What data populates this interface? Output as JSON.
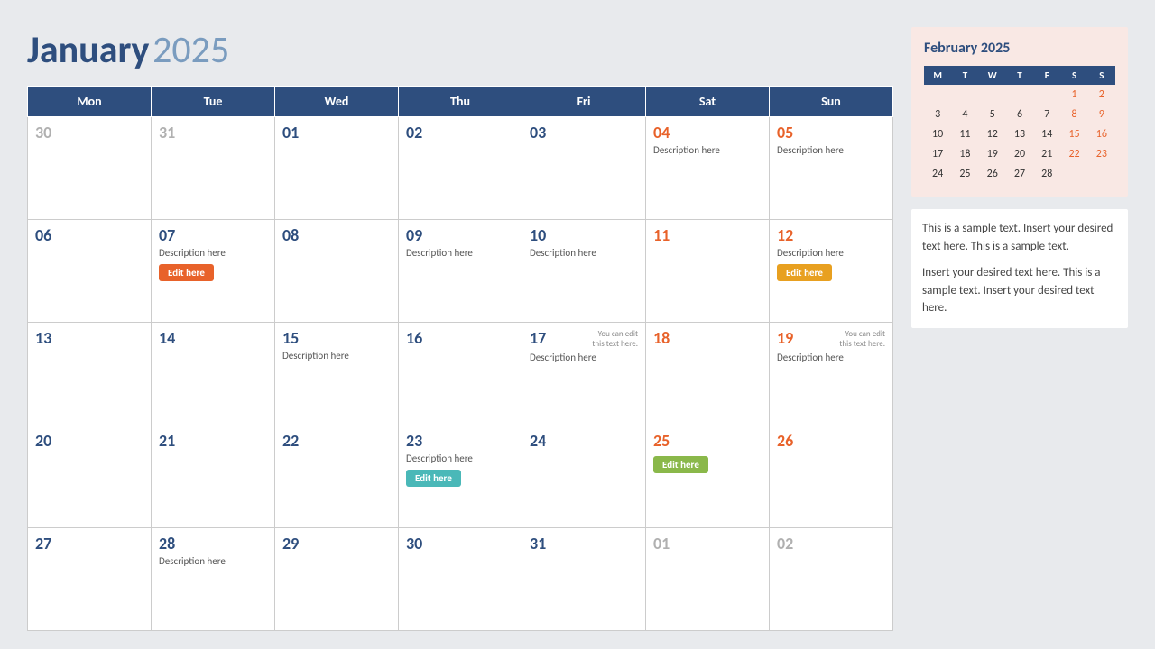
{
  "header": {
    "month": "January",
    "year": "2025"
  },
  "days_header": [
    "Mon",
    "Tue",
    "Wed",
    "Thu",
    "Fri",
    "Sat",
    "Sun"
  ],
  "weeks": [
    {
      "days": [
        {
          "num": "30",
          "type": "grayed"
        },
        {
          "num": "31",
          "type": "grayed"
        },
        {
          "num": "01",
          "type": "normal"
        },
        {
          "num": "02",
          "type": "normal"
        },
        {
          "num": "03",
          "type": "normal"
        },
        {
          "num": "04",
          "type": "weekend",
          "desc": "Description here"
        },
        {
          "num": "05",
          "type": "weekend",
          "desc": "Description here"
        }
      ]
    },
    {
      "days": [
        {
          "num": "06",
          "type": "normal"
        },
        {
          "num": "07",
          "type": "normal",
          "desc": "Description here",
          "btn": "Edit here",
          "btnColor": "red"
        },
        {
          "num": "08",
          "type": "normal"
        },
        {
          "num": "09",
          "type": "normal",
          "desc": "Description here"
        },
        {
          "num": "10",
          "type": "normal",
          "desc": "Description here"
        },
        {
          "num": "11",
          "type": "weekend"
        },
        {
          "num": "12",
          "type": "weekend",
          "desc": "Description here",
          "btn": "Edit here",
          "btnColor": "orange"
        }
      ]
    },
    {
      "days": [
        {
          "num": "13",
          "type": "normal"
        },
        {
          "num": "14",
          "type": "normal"
        },
        {
          "num": "15",
          "type": "normal",
          "desc": "Description here"
        },
        {
          "num": "16",
          "type": "normal"
        },
        {
          "num": "17",
          "type": "normal",
          "desc": "Description here",
          "note": "You can edit this text here."
        },
        {
          "num": "18",
          "type": "weekend"
        },
        {
          "num": "19",
          "type": "weekend",
          "desc": "Description here",
          "note": "You can edit this text here."
        }
      ]
    },
    {
      "days": [
        {
          "num": "20",
          "type": "normal"
        },
        {
          "num": "21",
          "type": "normal"
        },
        {
          "num": "22",
          "type": "normal"
        },
        {
          "num": "23",
          "type": "normal",
          "desc": "Description here",
          "btn": "Edit here",
          "btnColor": "teal"
        },
        {
          "num": "24",
          "type": "normal"
        },
        {
          "num": "25",
          "type": "weekend",
          "btn": "Edit here",
          "btnColor": "green"
        },
        {
          "num": "26",
          "type": "weekend"
        }
      ]
    },
    {
      "days": [
        {
          "num": "27",
          "type": "normal"
        },
        {
          "num": "28",
          "type": "normal",
          "desc": "Description here"
        },
        {
          "num": "29",
          "type": "normal"
        },
        {
          "num": "30",
          "type": "normal"
        },
        {
          "num": "31",
          "type": "normal"
        },
        {
          "num": "01",
          "type": "grayed"
        },
        {
          "num": "02",
          "type": "grayed"
        }
      ]
    }
  ],
  "mini_cal": {
    "title": "February 2025",
    "headers": [
      "M",
      "T",
      "W",
      "T",
      "F",
      "S",
      "S"
    ],
    "weeks": [
      [
        "",
        "",
        "",
        "",
        "",
        "1",
        "2"
      ],
      [
        "3",
        "4",
        "5",
        "6",
        "7",
        "8",
        "9"
      ],
      [
        "10",
        "11",
        "12",
        "13",
        "14",
        "15",
        "16"
      ],
      [
        "17",
        "18",
        "19",
        "20",
        "21",
        "22",
        "23"
      ],
      [
        "24",
        "25",
        "26",
        "27",
        "28",
        "",
        ""
      ]
    ]
  },
  "text_blocks": {
    "block1": "This is a sample text. Insert your desired text here. This is a sample text.",
    "block2": "Insert your desired text here. This is a sample text. Insert your desired text here."
  }
}
